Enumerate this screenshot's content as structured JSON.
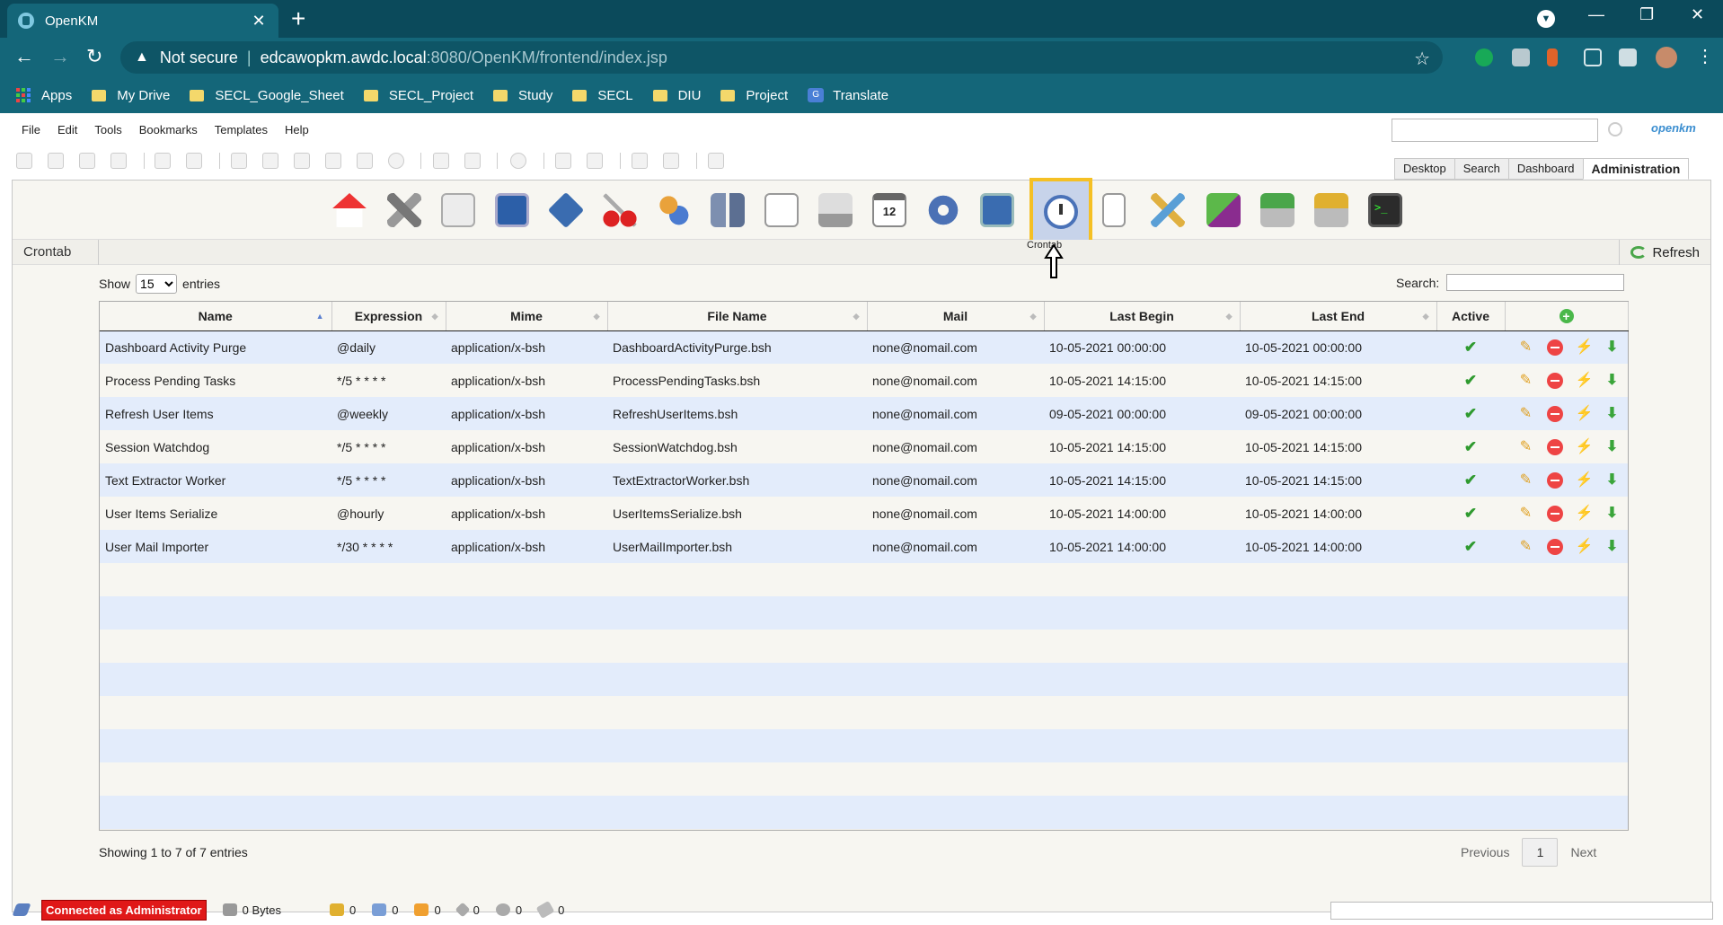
{
  "browser": {
    "tab_title": "OpenKM",
    "tab_close": "✕",
    "new_tab": "+",
    "security_label": "Not secure",
    "url_host": "edcawopkm.awdc.local",
    "url_rest": ":8080/OpenKM/frontend/index.jsp",
    "bookmarks": [
      "Apps",
      "My Drive",
      "SECL_Google_Sheet",
      "SECL_Project",
      "Study",
      "SECL",
      "DIU",
      "Project",
      "Translate"
    ]
  },
  "menu": [
    "File",
    "Edit",
    "Tools",
    "Bookmarks",
    "Templates",
    "Help"
  ],
  "logo_text": "openkm",
  "main_tabs": [
    "Desktop",
    "Search",
    "Dashboard",
    "Administration"
  ],
  "admin": {
    "icons": [
      "home",
      "tools",
      "search-doc",
      "monitor",
      "diamond",
      "scissors",
      "users",
      "database",
      "preview",
      "scanner",
      "calendar",
      "gear",
      "windows",
      "crontab",
      "dots",
      "brush",
      "folders",
      "import",
      "export",
      "terminal"
    ],
    "calendar_day": "12",
    "selected_icon_tooltip": "Crontab",
    "breadcrumb": "Crontab",
    "refresh_label": "Refresh"
  },
  "table": {
    "show_label": "Show",
    "entries_value": "15",
    "entries_label": "entries",
    "search_label": "Search:",
    "columns": [
      "Name",
      "Expression",
      "Mime",
      "File Name",
      "Mail",
      "Last Begin",
      "Last End",
      "Active"
    ],
    "rows": [
      {
        "name": "Dashboard Activity Purge",
        "expression": "@daily",
        "mime": "application/x-bsh",
        "file": "DashboardActivityPurge.bsh",
        "mail": "none@nomail.com",
        "begin": "10-05-2021 00:00:00",
        "end": "10-05-2021 00:00:00"
      },
      {
        "name": "Process Pending Tasks",
        "expression": "*/5 * * * *",
        "mime": "application/x-bsh",
        "file": "ProcessPendingTasks.bsh",
        "mail": "none@nomail.com",
        "begin": "10-05-2021 14:15:00",
        "end": "10-05-2021 14:15:00"
      },
      {
        "name": "Refresh User Items",
        "expression": "@weekly",
        "mime": "application/x-bsh",
        "file": "RefreshUserItems.bsh",
        "mail": "none@nomail.com",
        "begin": "09-05-2021 00:00:00",
        "end": "09-05-2021 00:00:00"
      },
      {
        "name": "Session Watchdog",
        "expression": "*/5 * * * *",
        "mime": "application/x-bsh",
        "file": "SessionWatchdog.bsh",
        "mail": "none@nomail.com",
        "begin": "10-05-2021 14:15:00",
        "end": "10-05-2021 14:15:00"
      },
      {
        "name": "Text Extractor Worker",
        "expression": "*/5 * * * *",
        "mime": "application/x-bsh",
        "file": "TextExtractorWorker.bsh",
        "mail": "none@nomail.com",
        "begin": "10-05-2021 14:15:00",
        "end": "10-05-2021 14:15:00"
      },
      {
        "name": "User Items Serialize",
        "expression": "@hourly",
        "mime": "application/x-bsh",
        "file": "UserItemsSerialize.bsh",
        "mail": "none@nomail.com",
        "begin": "10-05-2021 14:00:00",
        "end": "10-05-2021 14:00:00"
      },
      {
        "name": "User Mail Importer",
        "expression": "*/30 * * * *",
        "mime": "application/x-bsh",
        "file": "UserMailImporter.bsh",
        "mail": "none@nomail.com",
        "begin": "10-05-2021 14:00:00",
        "end": "10-05-2021 14:00:00"
      }
    ],
    "info": "Showing 1 to 7 of 7 entries",
    "prev_label": "Previous",
    "page": "1",
    "next_label": "Next"
  },
  "status": {
    "connected": "Connected as Administrator",
    "size": "0 Bytes",
    "counters": [
      "0",
      "0",
      "0",
      "0",
      "0",
      "0"
    ]
  }
}
